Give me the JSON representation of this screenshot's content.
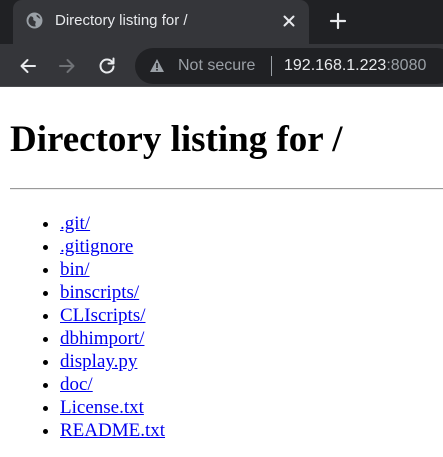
{
  "browser": {
    "tab": {
      "title": "Directory listing for /",
      "favicon": "globe-icon",
      "close_icon": "close-icon"
    },
    "new_tab_icon": "plus-icon",
    "toolbar": {
      "back_icon": "arrow-left-icon",
      "forward_icon": "arrow-right-icon",
      "reload_icon": "reload-icon",
      "security_icon": "warning-triangle-icon",
      "security_label": "Not secure",
      "url_host": "192.168.1.223",
      "url_port": ":8080"
    },
    "colors": {
      "tabstrip": "#202124",
      "active_tab": "#35363a",
      "omnibox": "#202124",
      "text": "#e8eaed",
      "muted_text": "#9aa0a6"
    }
  },
  "page": {
    "heading": "Directory listing for /",
    "entries": [
      ".git/",
      ".gitignore",
      "bin/",
      "binscripts/",
      "CLIscripts/",
      "dbhimport/",
      "display.py",
      "doc/",
      "License.txt",
      "README.txt"
    ],
    "colors": {
      "link": "#0000ee",
      "background": "#ffffff"
    }
  }
}
